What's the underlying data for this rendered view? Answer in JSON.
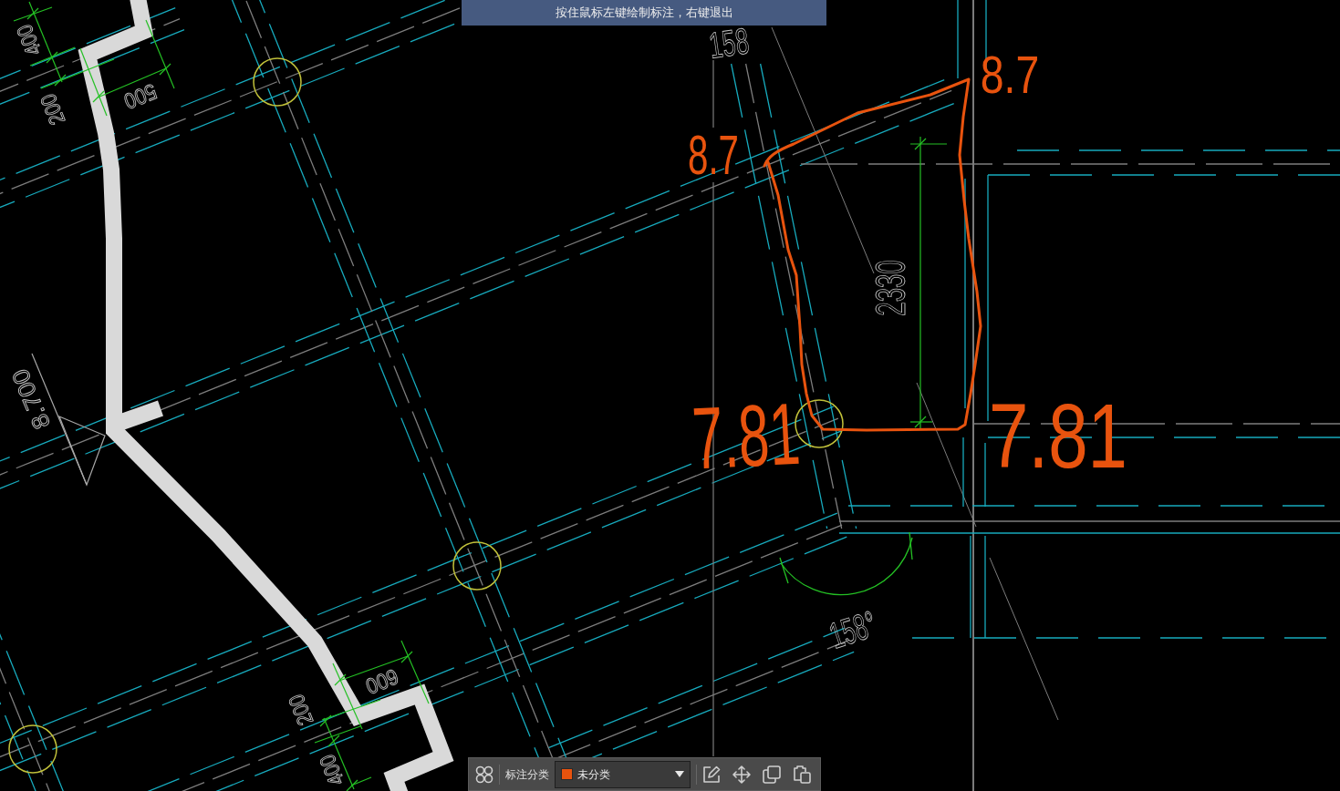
{
  "hint_banner": {
    "text": "按住鼠标左键绘制标注，右键退出"
  },
  "drawing": {
    "dimension_labels": [
      "400",
      "200",
      "500",
      "600",
      "200",
      "400",
      "2330"
    ],
    "elevation_label": "8.700",
    "angle_labels": [
      "158",
      "158°"
    ],
    "handwritten_labels": [
      "8.7",
      "8.7",
      "7.81",
      "7.81"
    ]
  },
  "toolbar": {
    "category_label": "标注分类",
    "category": {
      "value": "未分类",
      "color": "#e8530e"
    }
  }
}
